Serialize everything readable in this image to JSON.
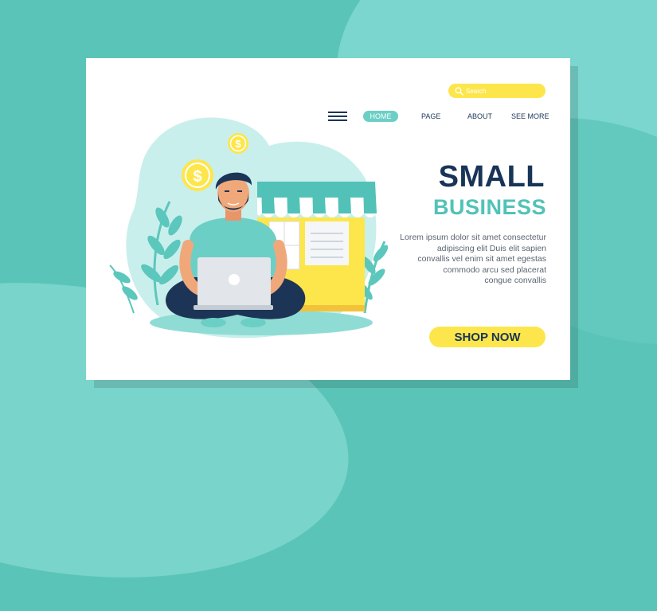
{
  "search": {
    "placeholder": "Search",
    "icon": "search-icon"
  },
  "nav": {
    "menu_icon": "hamburger-menu-icon",
    "items": [
      {
        "label": "HOME",
        "active": true
      },
      {
        "label": "PAGE",
        "active": false
      },
      {
        "label": "ABOUT",
        "active": false
      },
      {
        "label": "SEE MORE",
        "active": false
      }
    ]
  },
  "hero": {
    "title_line1": "SMALL",
    "title_line2": "BUSINESS",
    "description_lines": [
      "Lorem ipsum dolor sit amet consectetur",
      "adipiscing elit Duis  elit  sapien",
      "convallis vel enim sit amet egestas",
      "commodo arcu sed placerat",
      "congue convallis"
    ],
    "cta_label": "SHOP NOW"
  },
  "colors": {
    "background": "#5bc4b8",
    "accent_yellow": "#fde64b",
    "navy": "#183457",
    "teal": "#52c2b8"
  }
}
